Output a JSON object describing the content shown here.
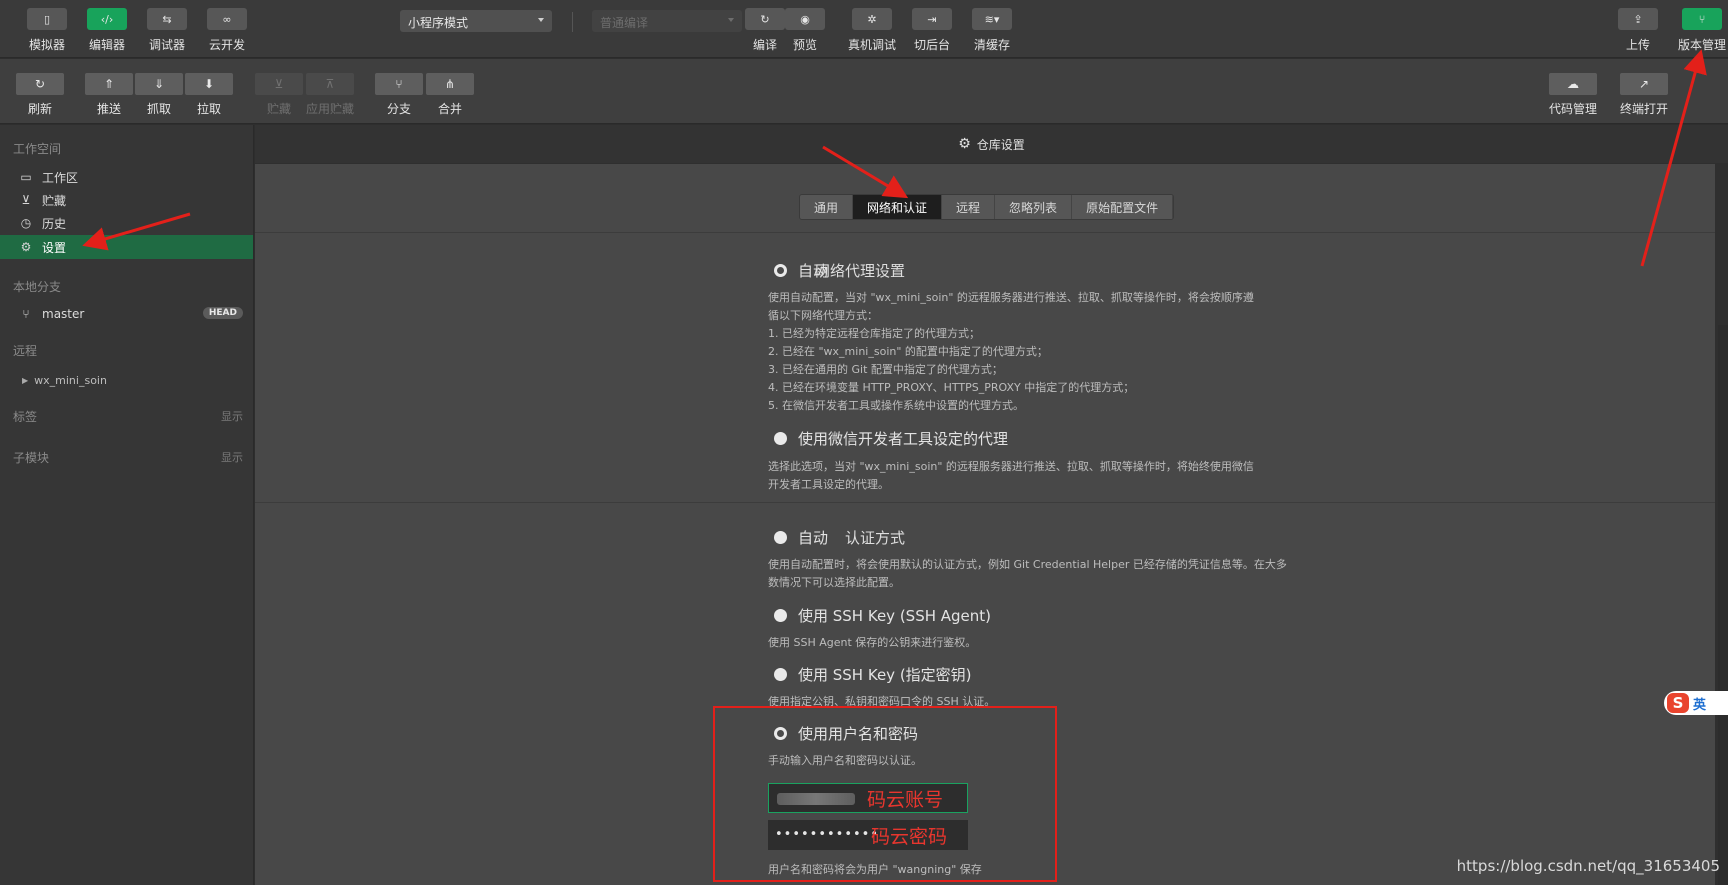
{
  "toolbar": {
    "left_buttons": [
      {
        "label": "模拟器",
        "icon": "phone-icon"
      },
      {
        "label": "编辑器",
        "icon": "code-icon"
      },
      {
        "label": "调试器",
        "icon": "debug-icon"
      },
      {
        "label": "云开发",
        "icon": "cloud-link-icon"
      }
    ],
    "mode_select": "小程序模式",
    "compile_select": "普通编译",
    "center_buttons": [
      {
        "label": "编译",
        "icon": "refresh-icon"
      },
      {
        "label": "预览",
        "icon": "eye-icon"
      },
      {
        "label": "真机调试",
        "icon": "bug-icon"
      },
      {
        "label": "切后台",
        "icon": "switch-icon"
      },
      {
        "label": "清缓存",
        "icon": "layers-icon"
      }
    ],
    "right_buttons": [
      {
        "label": "上传",
        "icon": "upload-icon"
      },
      {
        "label": "版本管理",
        "icon": "branch-icon"
      }
    ]
  },
  "gitbar": {
    "refresh": "刷新",
    "push": "推送",
    "fetch": "抓取",
    "pull": "拉取",
    "stash": "贮藏",
    "apply_stash": "应用贮藏",
    "branch": "分支",
    "merge": "合并",
    "code_manage": "代码管理",
    "terminal_open": "终端打开"
  },
  "sidebar": {
    "workspace_title": "工作空间",
    "items": [
      {
        "label": "工作区",
        "icon": "folder-icon"
      },
      {
        "label": "贮藏",
        "icon": "stash-icon"
      },
      {
        "label": "历史",
        "icon": "history-icon"
      },
      {
        "label": "设置",
        "icon": "gear-icon"
      }
    ],
    "local_branch_title": "本地分支",
    "branch_name": "master",
    "head_badge": "HEAD",
    "remote_title": "远程",
    "remote_name": "wx_mini_soin",
    "tags_title": "标签",
    "tags_show": "显示",
    "submodule_title": "子模块",
    "submodule_show": "显示"
  },
  "main": {
    "header": "仓库设置",
    "tabs": [
      "通用",
      "网络和认证",
      "远程",
      "忽略列表",
      "原始配置文件"
    ],
    "active_tab": "网络和认证",
    "proxy": {
      "label": "网络代理设置",
      "auto": "自动",
      "auto_desc_1": "使用自动配置，当对 \"wx_mini_soin\" 的远程服务器进行推送、拉取、抓取等操作时，将会按顺序遵",
      "auto_desc_2": "循以下网络代理方式：",
      "auto_desc_3": "1. 已经为特定远程仓库指定了的代理方式；",
      "auto_desc_4": "2. 已经在 \"wx_mini_soin\" 的配置中指定了的代理方式；",
      "auto_desc_5": "3. 已经在通用的 Git 配置中指定了的代理方式；",
      "auto_desc_6": "4. 已经在环境变量 HTTP_PROXY、HTTPS_PROXY 中指定了的代理方式；",
      "auto_desc_7": "5. 在微信开发者工具或操作系统中设置的代理方式。",
      "wechat": "使用微信开发者工具设定的代理",
      "wechat_desc_1": "选择此选项，当对 \"wx_mini_soin\" 的远程服务器进行推送、拉取、抓取等操作时，将始终使用微信",
      "wechat_desc_2": "开发者工具设定的代理。"
    },
    "auth": {
      "label": "认证方式",
      "auto": "自动",
      "auto_desc_1": "使用自动配置时，将会使用默认的认证方式，例如 Git Credential Helper 已经存储的凭证信息等。在大多",
      "auto_desc_2": "数情况下可以选择此配置。",
      "ssh_agent": "使用 SSH Key (SSH Agent)",
      "ssh_agent_desc": "使用 SSH Agent 保存的公钥来进行鉴权。",
      "ssh_key": "使用 SSH Key (指定密钥)",
      "ssh_key_desc": "使用指定公钥、私钥和密码口令的 SSH 认证。",
      "userpass": "使用用户名和密码",
      "userpass_desc": "手动输入用户名和密码以认证。",
      "password_value": "••••••••••••",
      "save_note": "用户名和密码将会为用户 \"wangning\" 保存"
    }
  },
  "annotations": {
    "account_note": "码云账号",
    "password_note": "码云密码",
    "arrow_color": "#e3201a"
  },
  "ime": {
    "letter": "S",
    "label": "英"
  },
  "watermark": "https://blog.csdn.net/qq_31653405"
}
